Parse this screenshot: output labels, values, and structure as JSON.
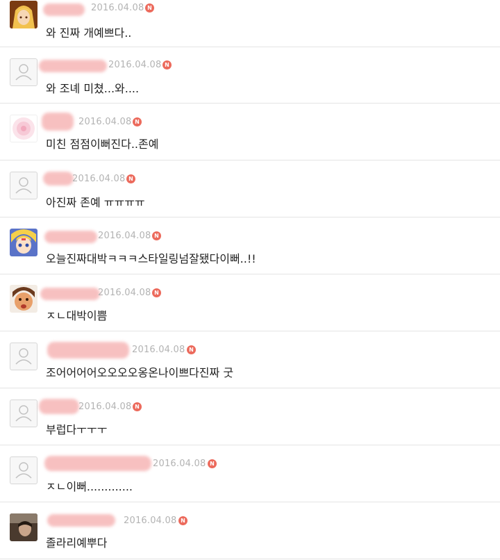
{
  "comments": [
    {
      "date": "2016.04.08",
      "badge": "N",
      "text": "와 진짜 개예쁘다..",
      "avatar": "anime-blonde-avatar"
    },
    {
      "date": "2016.04.08",
      "badge": "N",
      "text": "와 조녜 미쳤...와....",
      "avatar": "default-user-icon"
    },
    {
      "date": "2016.04.08",
      "badge": "N",
      "text": "미친 점점이뻐진다..존예",
      "avatar": "pink-circle-avatar"
    },
    {
      "date": "2016.04.08",
      "badge": "N",
      "text": "아진짜 존예 ㅠㅠㅠㅠ",
      "avatar": "default-user-icon"
    },
    {
      "date": "2016.04.08",
      "badge": "N",
      "text": "오늘진짜대박ㅋㅋㅋ스타일링넘잘됐다이뻐..!!",
      "avatar": "sailor-moon-avatar"
    },
    {
      "date": "2016.04.08",
      "badge": "N",
      "text": "ㅈㄴ대박이쁨",
      "avatar": "cartoon-face-avatar"
    },
    {
      "date": "2016.04.08",
      "badge": "N",
      "text": "조어어어어오오오오옹온나이쁘다진짜 굿",
      "avatar": "default-user-icon"
    },
    {
      "date": "2016.04.08",
      "badge": "N",
      "text": "부럽다ㅜㅜㅜ",
      "avatar": "default-user-icon"
    },
    {
      "date": "2016.04.08",
      "badge": "N",
      "text": "ㅈㄴ이뻐.............",
      "avatar": "default-user-icon"
    },
    {
      "date": "2016.04.08",
      "badge": "N",
      "text": "졸라리예뿌다",
      "avatar": "photo-avatar"
    }
  ]
}
